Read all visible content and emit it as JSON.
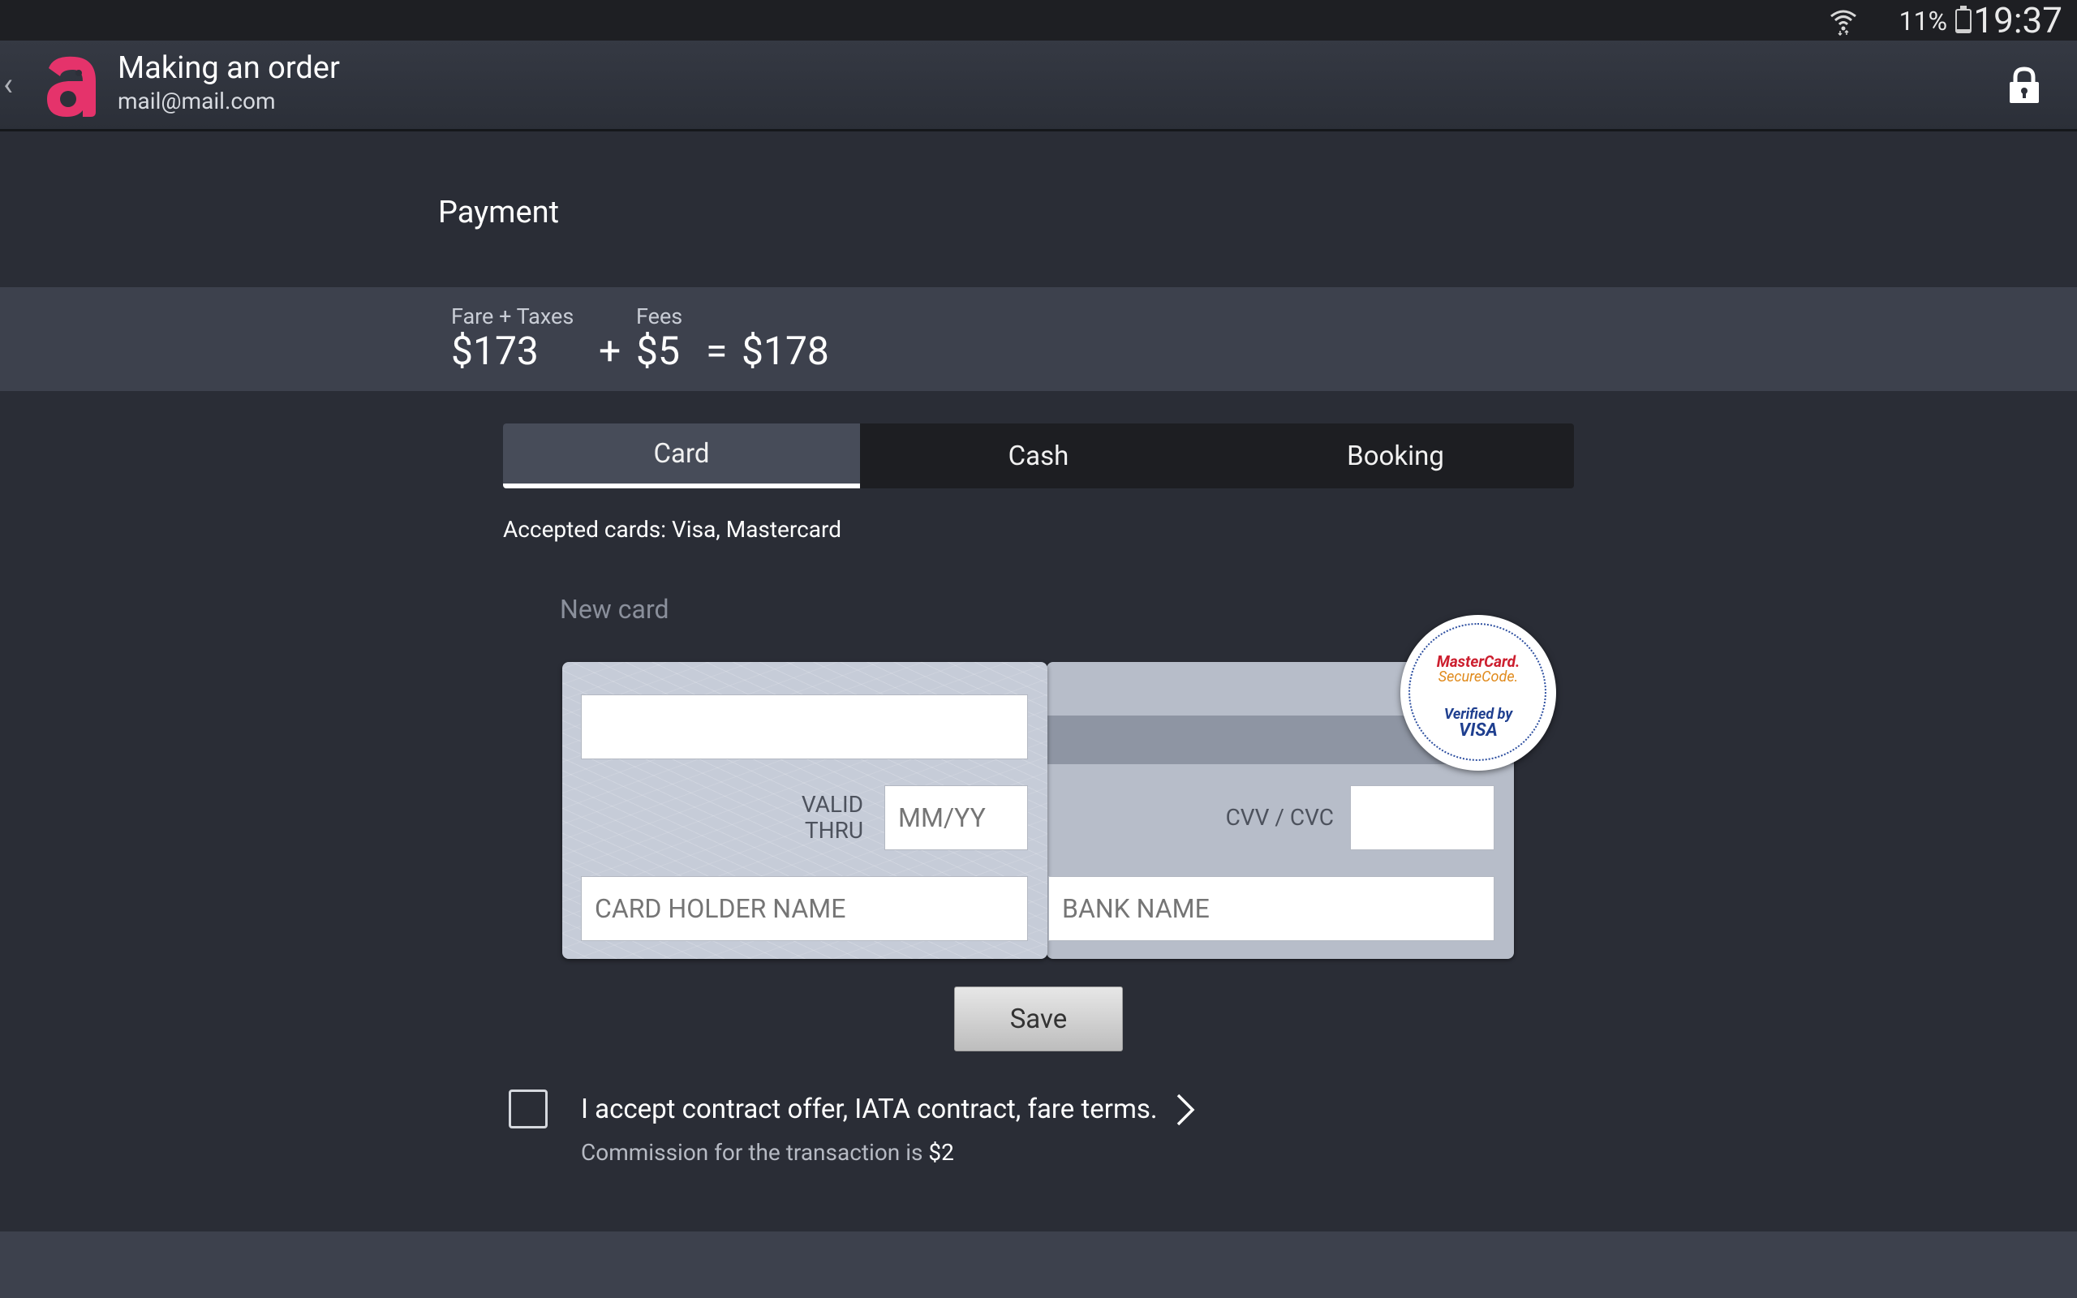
{
  "status_bar": {
    "battery": "11%",
    "time": "19:37"
  },
  "header": {
    "title": "Making an order",
    "subtitle": "mail@mail.com"
  },
  "page": {
    "heading": "Payment"
  },
  "price": {
    "fare_label": "Fare + Taxes",
    "fare_value": "$173",
    "plus": "+",
    "fees_label": "Fees",
    "fees_value": "$5",
    "equals": "=",
    "total": "$178"
  },
  "tabs": [
    {
      "label": "Card",
      "active": true
    },
    {
      "label": "Cash",
      "active": false
    },
    {
      "label": "Booking",
      "active": false
    }
  ],
  "accepted_cards": "Accepted cards: Visa, Mastercard",
  "new_card_label": "New card",
  "card_form": {
    "card_number": {
      "value": "",
      "placeholder": ""
    },
    "valid_thru_label_1": "VALID",
    "valid_thru_label_2": "THRU",
    "expiry": {
      "value": "",
      "placeholder": "MM/YY"
    },
    "cardholder": {
      "value": "",
      "placeholder": "CARD HOLDER NAME"
    },
    "cvv_label": "CVV / CVC",
    "cvv": {
      "value": "",
      "placeholder": ""
    },
    "bank": {
      "value": "",
      "placeholder": "BANK NAME"
    }
  },
  "secure_badge": {
    "line1": "MasterCard.",
    "line2": "SecureCode.",
    "line3": "Verified by",
    "line4": "VISA"
  },
  "save_label": "Save",
  "terms": {
    "checked": false,
    "text": "I accept contract offer, IATA contract, fare terms.",
    "commission_prefix": "Commission for the transaction is ",
    "commission_amount": "$2"
  },
  "colors": {
    "brand": "#e5336b",
    "background": "#2a2d36",
    "strip": "#3d414d"
  }
}
